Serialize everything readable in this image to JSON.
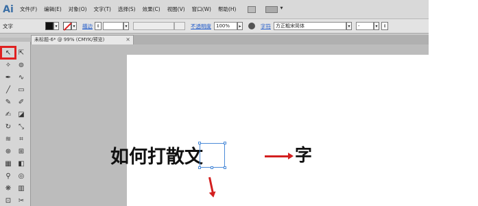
{
  "app": {
    "logo": "Ai",
    "menu": [
      "文件(F)",
      "编辑(E)",
      "对象(O)",
      "文字(T)",
      "选择(S)",
      "效果(C)",
      "视图(V)",
      "窗口(W)",
      "帮助(H)"
    ]
  },
  "control_bar": {
    "tool_label": "文字",
    "stroke_label": "描边",
    "opacity_label": "不透明度",
    "opacity_value": "100%",
    "char_label": "字符",
    "font_value": "方正粗宋简体",
    "font_style_value": "-"
  },
  "document": {
    "tab_title": "未标题-6* @ 99% (CMYK/预览)",
    "tab_close": "×"
  },
  "toolbox": {
    "tools": [
      "selection",
      "direct-selection",
      "magic-wand",
      "lasso",
      "pen",
      "curvature",
      "line",
      "rectangle",
      "paintbrush",
      "pencil",
      "blob-brush",
      "eraser",
      "rotate",
      "scale",
      "warp",
      "free-transform",
      "shape-builder",
      "perspective",
      "mesh",
      "gradient",
      "eyedropper",
      "blend",
      "symbol-sprayer",
      "column-graph",
      "artboard",
      "slice"
    ]
  },
  "artwork": {
    "headline": "如何打散文",
    "result_char": "字",
    "colors": {
      "arrow": "#d31f1f",
      "selection": "#4a8ad8"
    }
  }
}
